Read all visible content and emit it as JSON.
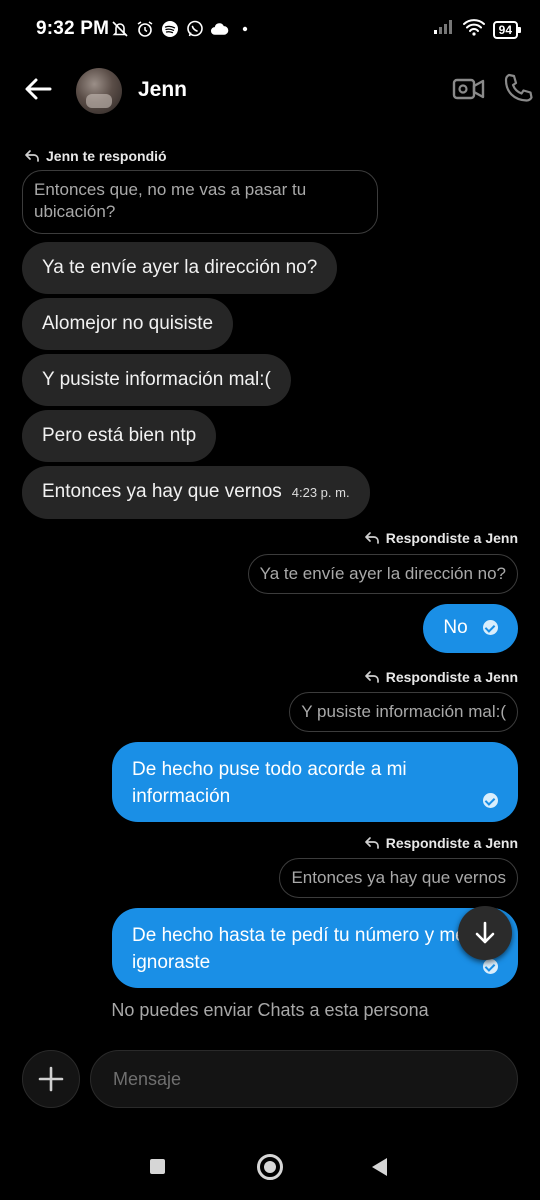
{
  "status_bar": {
    "time": "9:32 PM",
    "battery": "94"
  },
  "header": {
    "contact_name": "Jenn"
  },
  "messages": {
    "incoming_reply_label": "Jenn te respondió",
    "incoming_quote": "Entonces que, no me vas a pasar tu ubicación?",
    "incoming": [
      {
        "text": "Ya te envíe ayer la dirección no?"
      },
      {
        "text": "Alomejor no quisiste"
      },
      {
        "text": "Y pusiste información mal:("
      },
      {
        "text": "Pero está bien ntp"
      },
      {
        "text": "Entonces ya hay que vernos",
        "time": "4:23 p. m."
      }
    ],
    "outgoing_reply_label": "Respondiste a Jenn",
    "outgoing": [
      {
        "quote": "Ya te envíe ayer la dirección no?",
        "text": "No"
      },
      {
        "quote": "Y pusiste información mal:(",
        "text": "De hecho puse todo acorde a mi información"
      },
      {
        "quote": "Entonces ya hay que vernos",
        "text": "De hecho hasta te pedí tu número y me ignoraste"
      }
    ]
  },
  "notice": "No puedes enviar Chats a esta persona",
  "composer": {
    "placeholder": "Mensaje"
  },
  "colors": {
    "outgoing_bubble": "#1a8fe6",
    "incoming_bubble": "#262626",
    "background": "#000000"
  }
}
